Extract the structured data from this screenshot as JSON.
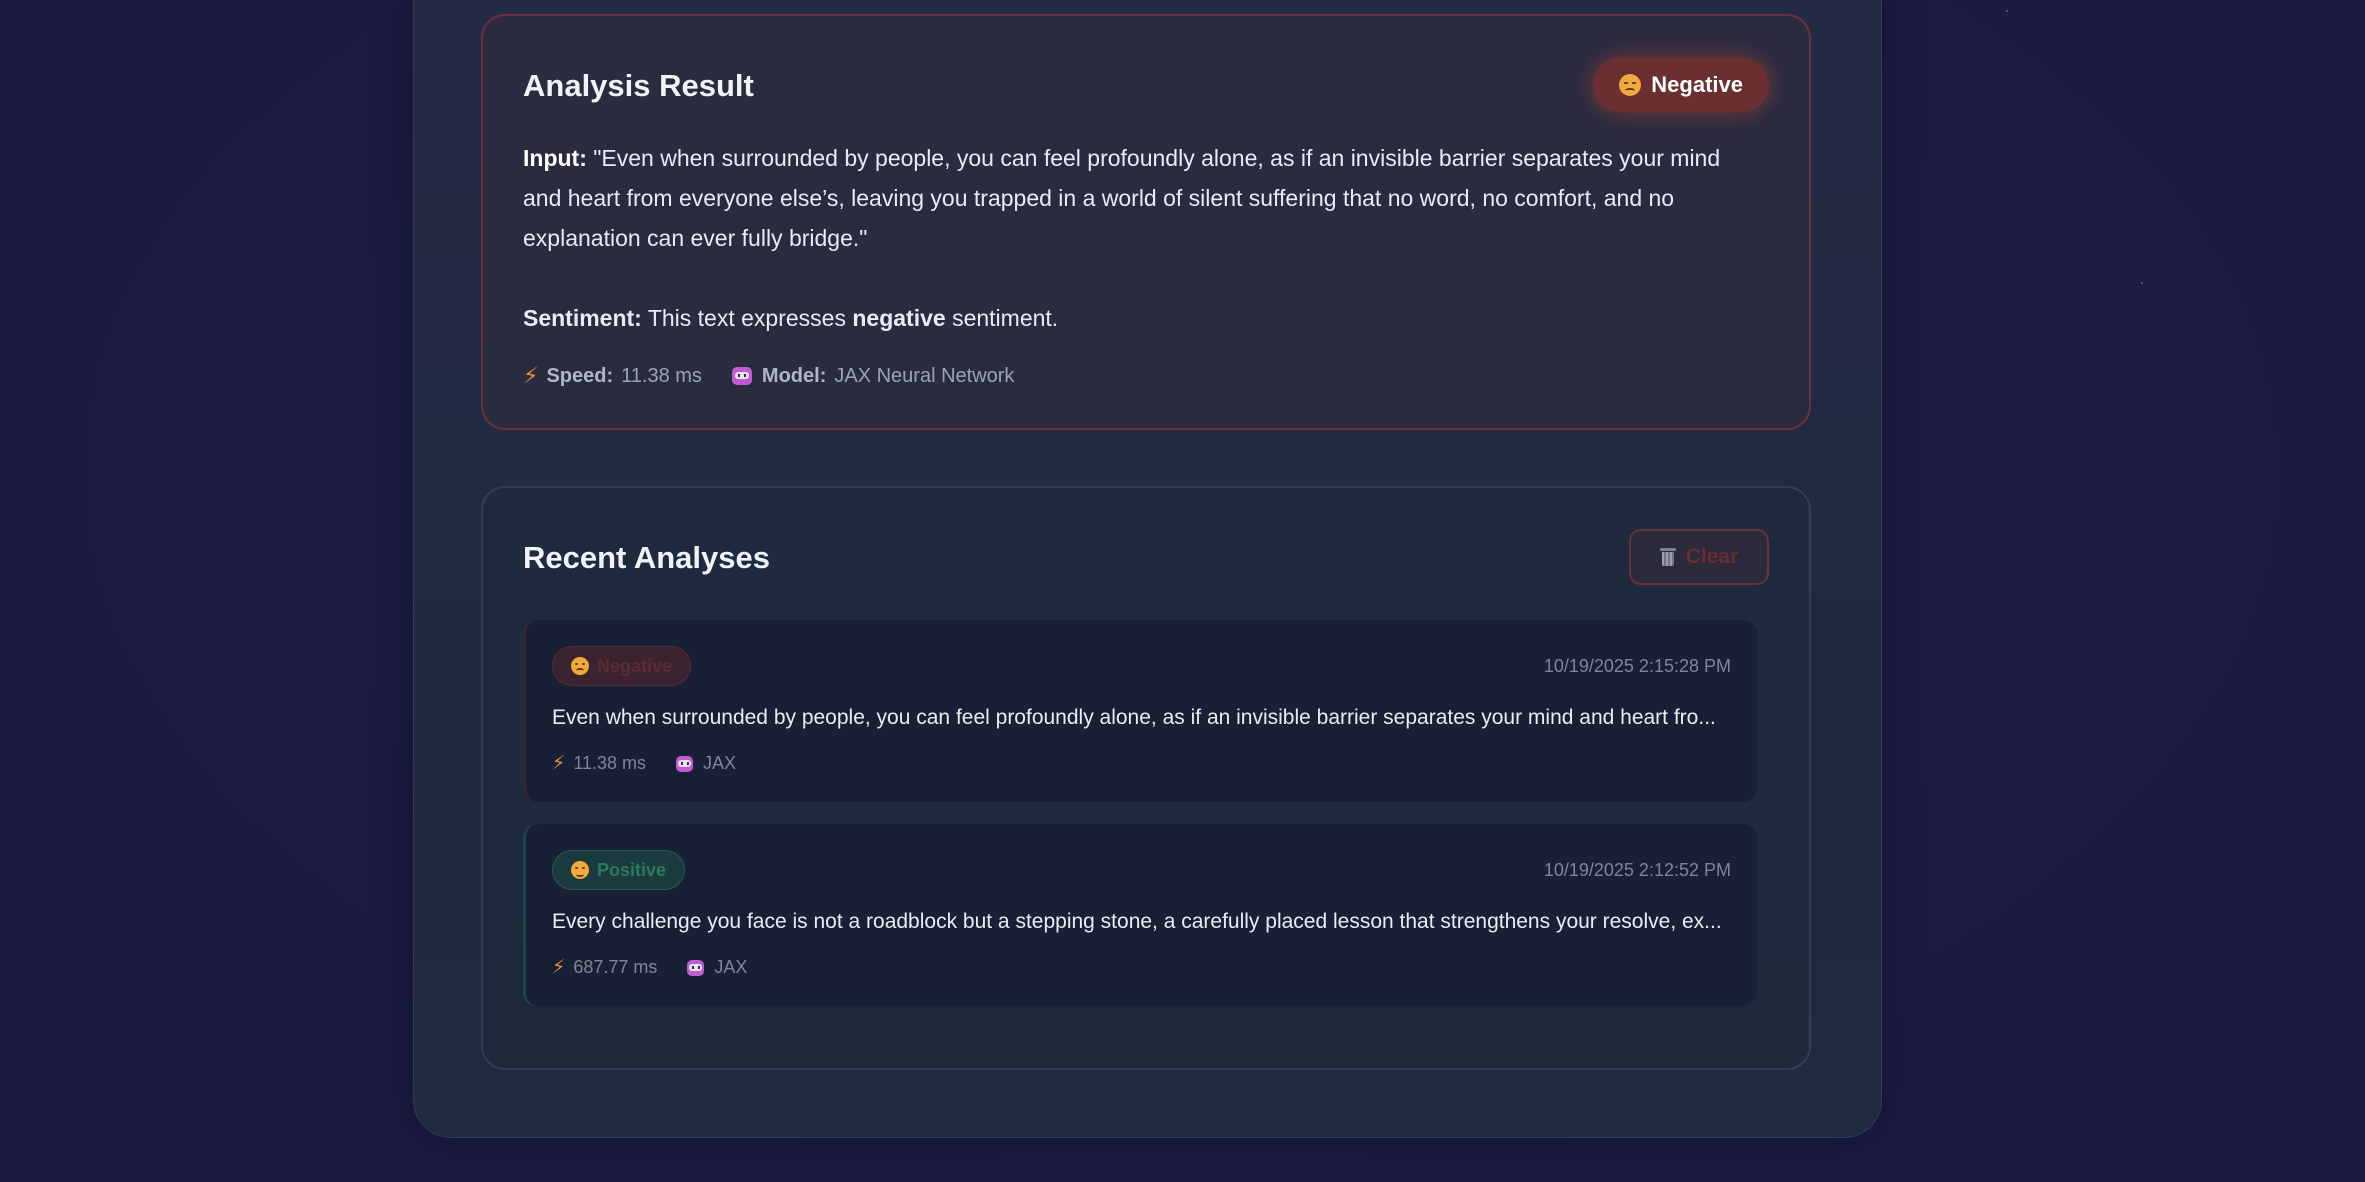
{
  "result": {
    "title": "Analysis Result",
    "badge_label": "Negative",
    "badge_emoji": "disappointed-face-icon",
    "input_label": "Input:",
    "input_text": "\"Even when surrounded by people, you can feel profoundly alone, as if an invisible barrier separates your mind and heart from everyone else’s, leaving you trapped in a world of silent suffering that no word, no comfort, and no explanation can ever fully bridge.\"",
    "sentiment_label": "Sentiment:",
    "sentiment_prefix": "This text expresses",
    "sentiment_value": "negative",
    "sentiment_suffix": "sentiment.",
    "speed_label": "Speed:",
    "speed_value": "11.38 ms",
    "model_label": "Model:",
    "model_value": "JAX Neural Network"
  },
  "recent": {
    "title": "Recent Analyses",
    "clear_label": "Clear",
    "items": [
      {
        "badge": "Negative",
        "timestamp": "10/19/2025 2:15:28 PM",
        "text": "Even when surrounded by people, you can feel profoundly alone, as if an invisible barrier separates your mind and heart fro...",
        "speed": "11.38 ms",
        "model": "JAX"
      },
      {
        "badge": "Positive",
        "timestamp": "10/19/2025 2:12:52 PM",
        "text": "Every challenge you face is not a roadblock but a stepping stone, a carefully placed lesson that strengthens your resolve, ex...",
        "speed": "687.77 ms",
        "model": "JAX"
      }
    ]
  },
  "colors": {
    "negative_accent": "#6a2f31",
    "positive_accent": "#2c7a5c",
    "background": "#1c1c45"
  }
}
